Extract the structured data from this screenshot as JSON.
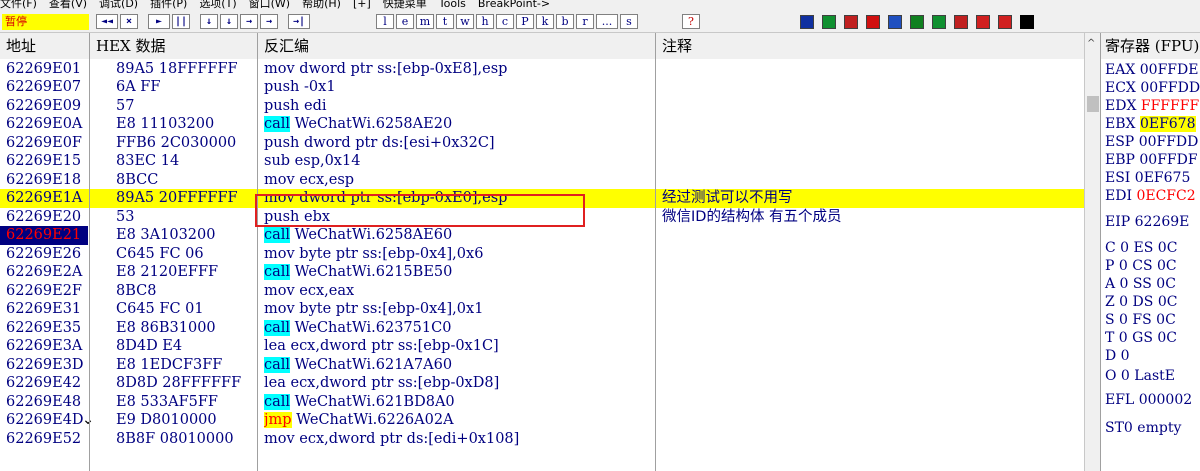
{
  "menu": [
    "文件(F)",
    "查看(V)",
    "调试(D)",
    "插件(P)",
    "选项(T)",
    "窗口(W)",
    "帮助(H)",
    "[+]",
    "快捷菜单",
    "Tools",
    "BreakPoint->"
  ],
  "toolbar": {
    "status": "暂停",
    "buttons": [
      "◄◄",
      "×",
      "►",
      "||",
      "↓",
      "↓",
      "→",
      "→",
      "→|"
    ],
    "letters": [
      "l",
      "e",
      "m",
      "t",
      "w",
      "h",
      "c",
      "P",
      "k",
      "b",
      "r",
      "...",
      "s"
    ],
    "help_label": "?",
    "plugins": [
      {
        "name": "plugin-1",
        "color": "#1030a0"
      },
      {
        "name": "plugin-2",
        "color": "#109030"
      },
      {
        "name": "plugin-3",
        "color": "#c02020"
      },
      {
        "name": "plugin-4",
        "color": "#d01010"
      },
      {
        "name": "plugin-5",
        "color": "#2050c0"
      },
      {
        "name": "plugin-6",
        "color": "#108020"
      },
      {
        "name": "plugin-7",
        "color": "#109030"
      },
      {
        "name": "plugin-8",
        "color": "#c02020"
      },
      {
        "name": "plugin-9",
        "color": "#d02020"
      },
      {
        "name": "plugin-10",
        "color": "#d02020"
      }
    ]
  },
  "columns": {
    "address": "地址",
    "hex": "HEX 数据",
    "disasm": "反汇编",
    "comment": "注释"
  },
  "rows": [
    {
      "addr": "62269E01",
      "hex": "89A5 18FFFFFF",
      "op": "mov",
      "args": "dword ptr ss:[ebp-0xE8],esp",
      "comment": ""
    },
    {
      "addr": "62269E07",
      "hex": "6A FF",
      "op": "push",
      "args": "-0x1",
      "comment": ""
    },
    {
      "addr": "62269E09",
      "hex": "57",
      "op": "push",
      "args": "edi",
      "comment": ""
    },
    {
      "addr": "62269E0A",
      "hex": "E8 11103200",
      "op": "call",
      "args": "WeChatWi.6258AE20",
      "comment": ""
    },
    {
      "addr": "62269E0F",
      "hex": "FFB6 2C030000",
      "op": "push",
      "args": "dword ptr ds:[esi+0x32C]",
      "comment": ""
    },
    {
      "addr": "62269E15",
      "hex": "83EC 14",
      "op": "sub",
      "args": "esp,0x14",
      "comment": ""
    },
    {
      "addr": "62269E18",
      "hex": "8BCC",
      "op": "mov",
      "args": "ecx,esp",
      "comment": ""
    },
    {
      "addr": "62269E1A",
      "hex": "89A5 20FFFFFF",
      "op": "mov",
      "args": "dword ptr ss:[ebp-0xE0],esp",
      "comment": "经过测试可以不用写",
      "selected": true
    },
    {
      "addr": "62269E20",
      "hex": "53",
      "op": "push",
      "args": "ebx",
      "comment": "微信ID的结构体 有五个成员"
    },
    {
      "addr": "62269E21",
      "hex": "E8 3A103200",
      "op": "call",
      "args": "WeChatWi.6258AE60",
      "comment": "",
      "eip": true
    },
    {
      "addr": "62269E26",
      "hex": "C645 FC 06",
      "op": "mov",
      "args": "byte ptr ss:[ebp-0x4],0x6",
      "comment": ""
    },
    {
      "addr": "62269E2A",
      "hex": "E8 2120EFFF",
      "op": "call",
      "args": "WeChatWi.6215BE50",
      "comment": ""
    },
    {
      "addr": "62269E2F",
      "hex": "8BC8",
      "op": "mov",
      "args": "ecx,eax",
      "comment": ""
    },
    {
      "addr": "62269E31",
      "hex": "C645 FC 01",
      "op": "mov",
      "args": "byte ptr ss:[ebp-0x4],0x1",
      "comment": ""
    },
    {
      "addr": "62269E35",
      "hex": "E8 86B31000",
      "op": "call",
      "args": "WeChatWi.623751C0",
      "comment": ""
    },
    {
      "addr": "62269E3A",
      "hex": "8D4D E4",
      "op": "lea",
      "args": "ecx,dword ptr ss:[ebp-0x1C]",
      "comment": ""
    },
    {
      "addr": "62269E3D",
      "hex": "E8 1EDCF3FF",
      "op": "call",
      "args": "WeChatWi.621A7A60",
      "comment": ""
    },
    {
      "addr": "62269E42",
      "hex": "8D8D 28FFFFFF",
      "op": "lea",
      "args": "ecx,dword ptr ss:[ebp-0xD8]",
      "comment": ""
    },
    {
      "addr": "62269E48",
      "hex": "E8 533AF5FF",
      "op": "call",
      "args": "WeChatWi.621BD8A0",
      "comment": ""
    },
    {
      "addr": "62269E4D",
      "hex": "E9 D8010000",
      "op": "jmp",
      "args": "WeChatWi.6226A02A",
      "comment": "",
      "jump_marker": "⌄"
    },
    {
      "addr": "62269E52",
      "hex": "8B8F 08010000",
      "op": "mov",
      "args": "ecx,dword ptr ds:[edi+0x108]",
      "comment": ""
    }
  ],
  "registers": {
    "title": "寄存器 (FPU)",
    "items": [
      {
        "name": "EAX",
        "value": "00FFDE",
        "style": ""
      },
      {
        "name": "ECX",
        "value": "00FFDD",
        "style": ""
      },
      {
        "name": "EDX",
        "value": "FFFFFF",
        "style": "red"
      },
      {
        "name": "EBX",
        "value": "0EF678",
        "style": "yellow"
      },
      {
        "name": "ESP",
        "value": "00FFDD",
        "style": ""
      },
      {
        "name": "EBP",
        "value": "00FFDF",
        "style": ""
      },
      {
        "name": "ESI",
        "value": "0EF675",
        "style": ""
      },
      {
        "name": "EDI",
        "value": "0ECFC2",
        "style": "red"
      },
      {
        "name": "EIP",
        "value": "62269E",
        "style": ""
      },
      {
        "name": "C 0",
        "value": "ES 0C",
        "style": ""
      },
      {
        "name": "P 0",
        "value": "CS 0C",
        "style": ""
      },
      {
        "name": "A 0",
        "value": "SS 0C",
        "style": ""
      },
      {
        "name": "Z 0",
        "value": "DS 0C",
        "style": ""
      },
      {
        "name": "S 0",
        "value": "FS 0C",
        "style": ""
      },
      {
        "name": "T 0",
        "value": "GS 0C",
        "style": ""
      },
      {
        "name": "D 0",
        "value": "",
        "style": ""
      },
      {
        "name": "O 0",
        "value": "LastE",
        "style": ""
      },
      {
        "name": "EFL",
        "value": "000002",
        "style": ""
      },
      {
        "name": "ST0",
        "value": "empty",
        "style": ""
      }
    ]
  },
  "colors": {
    "selected_row": "#ffff00",
    "call_bg": "#00ffff",
    "eip_bg": "#000080",
    "highlight_box": "#e02020"
  }
}
